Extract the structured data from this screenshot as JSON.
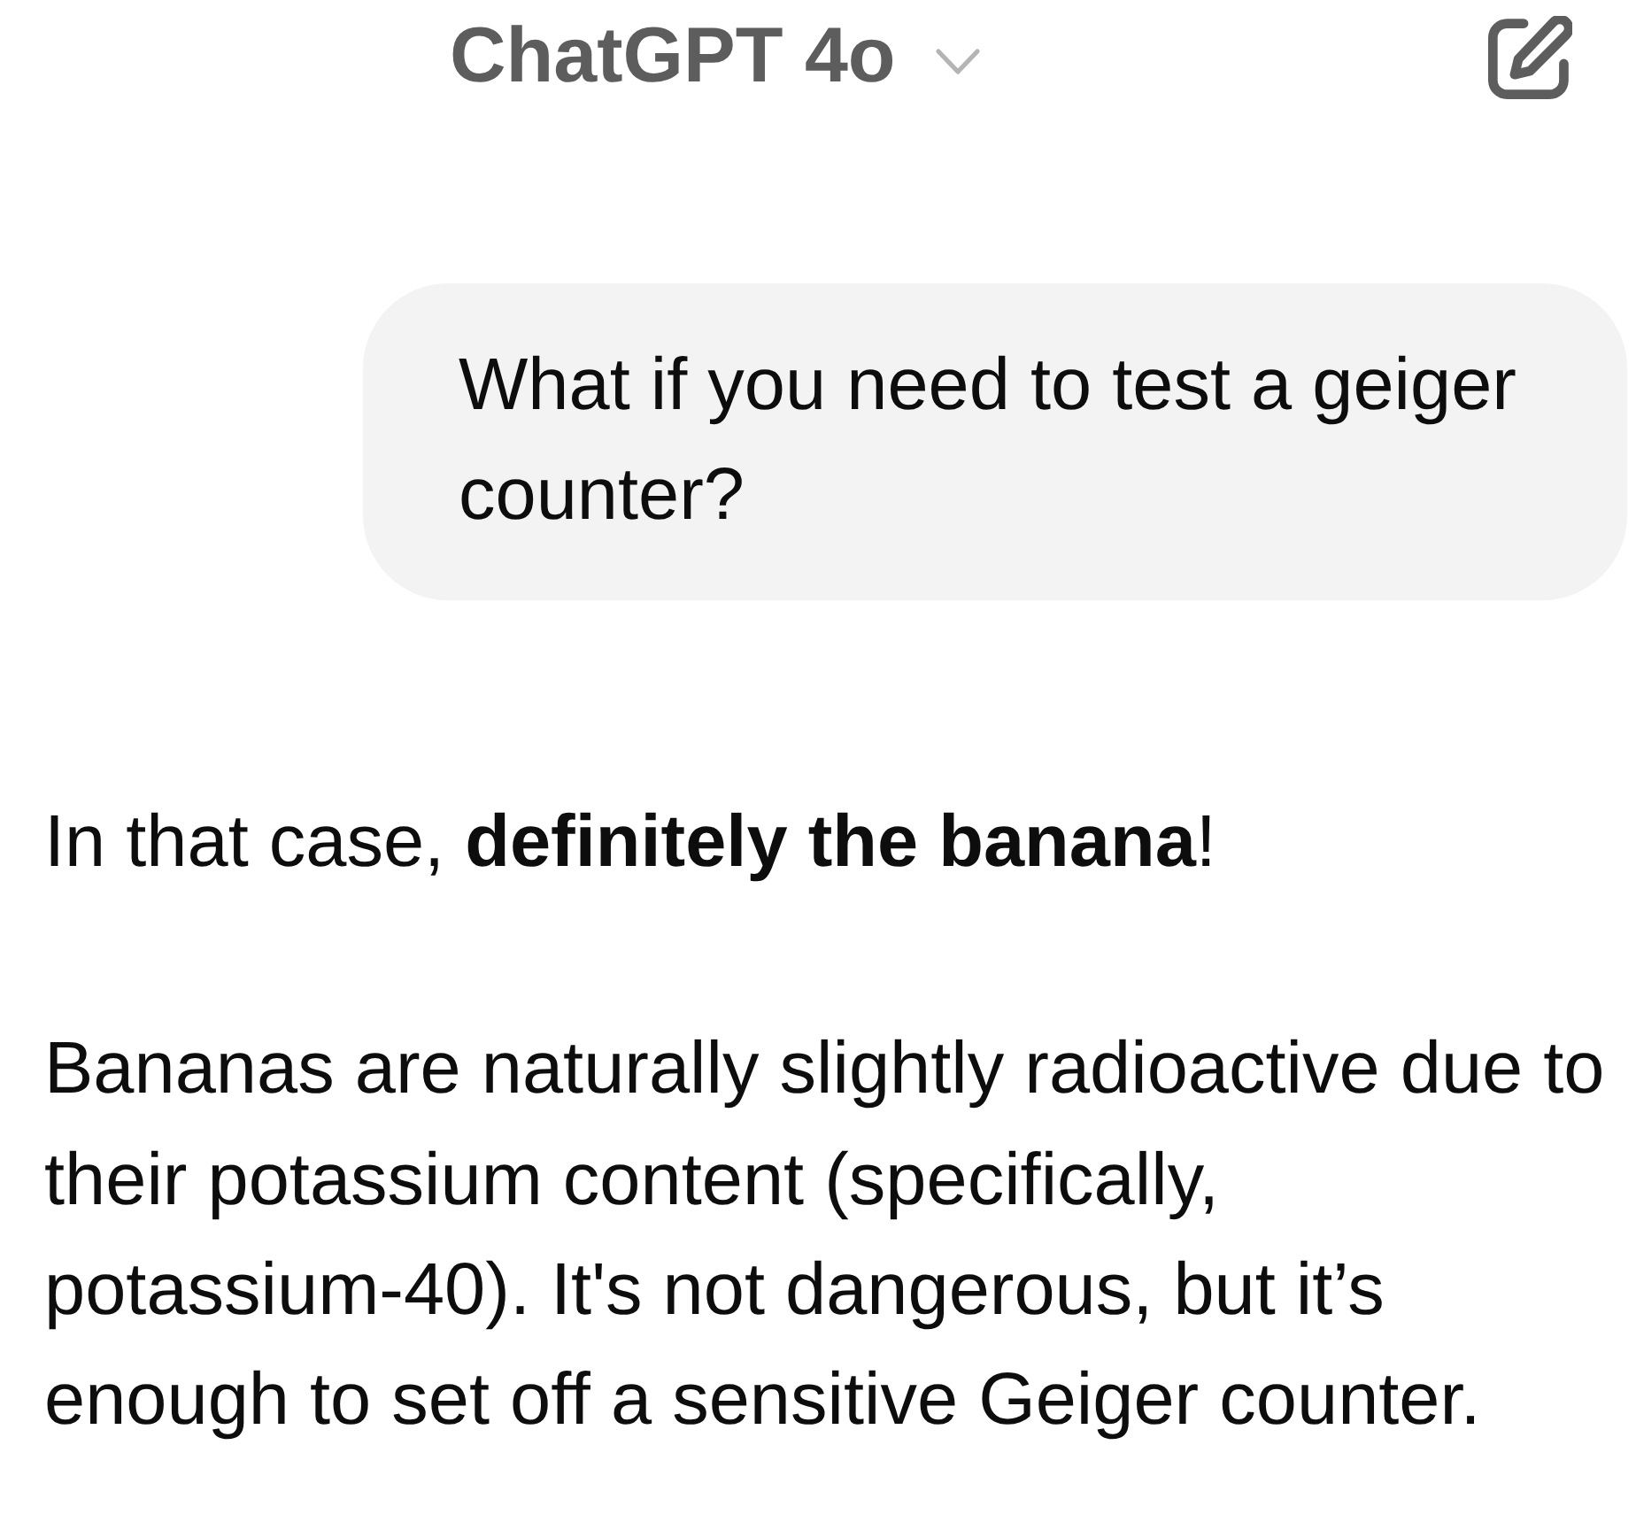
{
  "header": {
    "title": "ChatGPT 4o"
  },
  "messages": [
    {
      "kind": "prompt",
      "text": "What if you need to test a geiger counter?"
    },
    {
      "kind": "reply",
      "paragraphs": [
        "In that case, **definitely the banana**!",
        "Bananas are naturally slightly radioactive due to their potassium content (specifically, potassium-40). It's not dangerous, but it’s enough to set off a sensitive Geiger counter."
      ]
    }
  ]
}
